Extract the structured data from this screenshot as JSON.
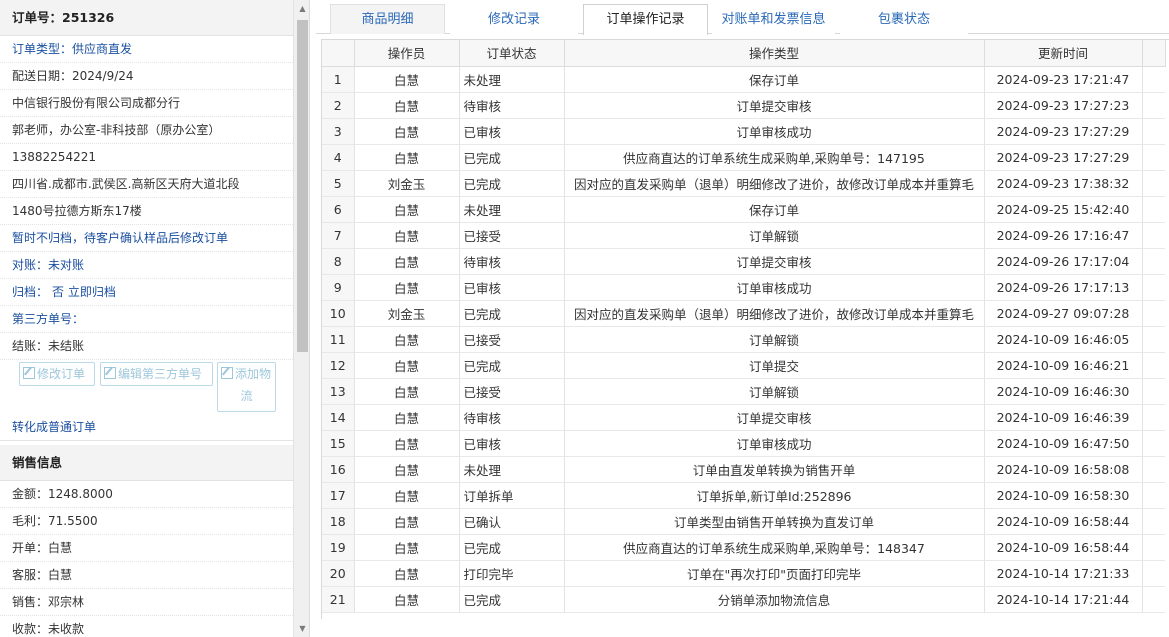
{
  "order": {
    "title": "订单号：251326",
    "type": "订单类型：供应商直发",
    "delivery_date": "配送日期：2024/9/24",
    "company": "中信银行股份有限公司成都分行",
    "contact": "郭老师，办公室-非科技部（原办公室）",
    "phone": "13882254221",
    "address_line1": "四川省.成都市.武侯区.高新区天府大道北段",
    "address_line2": "1480号拉德方斯东17楼",
    "note": "暂时不归档，待客户确认样品后修改订单",
    "reconcile_label": "对账：",
    "reconcile_value": "未对账",
    "archive_label": "归档：",
    "archive_value": "否 立即归档",
    "third_party": "第三方单号：",
    "settle": "结账：未结账",
    "btn_modify": "修改订单",
    "btn_edit_third": "编辑第三方单号",
    "btn_add_logistics_1": "添加物",
    "btn_add_logistics_2": "流",
    "convert": "转化成普通订单"
  },
  "sales": {
    "title": "销售信息",
    "amount": "金额：1248.8000",
    "profit": "毛利：71.5500",
    "opener": "开单：白慧",
    "service": "客服：白慧",
    "salesman": "销售：邓宗林",
    "receipt": "收款：未收款"
  },
  "tabs": [
    {
      "label": "商品明细"
    },
    {
      "label": "修改记录"
    },
    {
      "label": "订单操作记录"
    },
    {
      "label": "对账单和发票信息"
    },
    {
      "label": "包裹状态"
    }
  ],
  "table": {
    "headers": [
      "",
      "操作员",
      "订单状态",
      "操作类型",
      "更新时间"
    ],
    "rows": [
      [
        "1",
        "白慧",
        "未处理",
        "保存订单",
        "2024-09-23 17:21:47"
      ],
      [
        "2",
        "白慧",
        "待审核",
        "订单提交审核",
        "2024-09-23 17:27:23"
      ],
      [
        "3",
        "白慧",
        "已审核",
        "订单审核成功",
        "2024-09-23 17:27:29"
      ],
      [
        "4",
        "白慧",
        "已完成",
        "供应商直达的订单系统生成采购单,采购单号：147195",
        "2024-09-23 17:27:29"
      ],
      [
        "5",
        "刘金玉",
        "已完成",
        "因对应的直发采购单（退单）明细修改了进价，故修改订单成本并重算毛",
        "2024-09-23 17:38:32"
      ],
      [
        "6",
        "白慧",
        "未处理",
        "保存订单",
        "2024-09-25 15:42:40"
      ],
      [
        "7",
        "白慧",
        "已接受",
        "订单解锁",
        "2024-09-26 17:16:47"
      ],
      [
        "8",
        "白慧",
        "待审核",
        "订单提交审核",
        "2024-09-26 17:17:04"
      ],
      [
        "9",
        "白慧",
        "已审核",
        "订单审核成功",
        "2024-09-26 17:17:13"
      ],
      [
        "10",
        "刘金玉",
        "已完成",
        "因对应的直发采购单（退单）明细修改了进价，故修改订单成本并重算毛",
        "2024-09-27 09:07:28"
      ],
      [
        "11",
        "白慧",
        "已接受",
        "订单解锁",
        "2024-10-09 16:46:05"
      ],
      [
        "12",
        "白慧",
        "已完成",
        "订单提交",
        "2024-10-09 16:46:21"
      ],
      [
        "13",
        "白慧",
        "已接受",
        "订单解锁",
        "2024-10-09 16:46:30"
      ],
      [
        "14",
        "白慧",
        "待审核",
        "订单提交审核",
        "2024-10-09 16:46:39"
      ],
      [
        "15",
        "白慧",
        "已审核",
        "订单审核成功",
        "2024-10-09 16:47:50"
      ],
      [
        "16",
        "白慧",
        "未处理",
        "订单由直发单转换为销售开单",
        "2024-10-09 16:58:08"
      ],
      [
        "17",
        "白慧",
        "订单拆单",
        "订单拆单,新订单Id:252896",
        "2024-10-09 16:58:30"
      ],
      [
        "18",
        "白慧",
        "已确认",
        "订单类型由销售开单转换为直发订单",
        "2024-10-09 16:58:44"
      ],
      [
        "19",
        "白慧",
        "已完成",
        "供应商直达的订单系统生成采购单,采购单号：148347",
        "2024-10-09 16:58:44"
      ],
      [
        "20",
        "白慧",
        "打印完毕",
        "订单在\"再次打印\"页面打印完毕",
        "2024-10-14 17:21:33"
      ],
      [
        "21",
        "白慧",
        "已完成",
        "分销单添加物流信息",
        "2024-10-14 17:21:44"
      ]
    ]
  }
}
